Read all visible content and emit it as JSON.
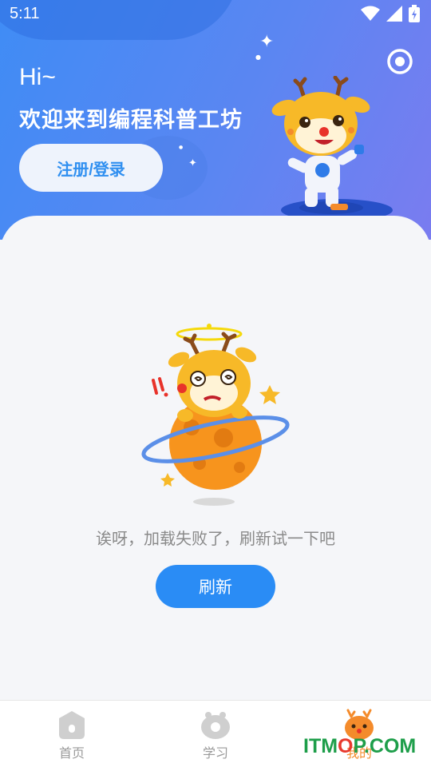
{
  "status_bar": {
    "time": "5:11"
  },
  "header": {
    "greeting": "Hi~",
    "welcome": "欢迎来到编程科普工坊",
    "login_button": "注册/登录"
  },
  "error": {
    "message": "诶呀，加载失败了，刷新试一下吧",
    "refresh_button": "刷新"
  },
  "tabs": [
    {
      "label": "首页",
      "icon": "home-icon"
    },
    {
      "label": "学习",
      "icon": "study-icon"
    },
    {
      "label": "我的",
      "icon": "mascot-profile-icon",
      "active": true
    }
  ],
  "watermark": {
    "prefix": "ITM",
    "o": "O",
    "suffix": "P.COM"
  },
  "colors": {
    "accent": "#2a8cf5",
    "header": "#4f8af3",
    "mascot": "#f5a623"
  }
}
